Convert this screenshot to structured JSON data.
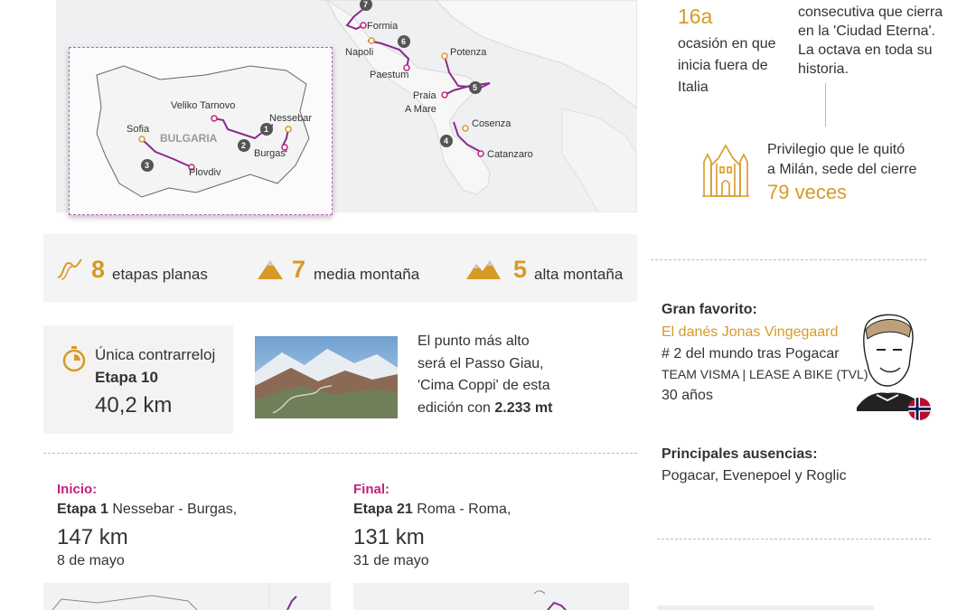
{
  "map": {
    "italy_labels": {
      "formia": "Formia",
      "napoli": "Napoli",
      "paestum": "Paestum",
      "potenza": "Potenza",
      "praia": "Praia",
      "amare": "A Mare",
      "cosenza": "Cosenza",
      "catanzaro": "Catanzaro"
    },
    "italy_stage_numbers": {
      "s7": "7",
      "s6": "6",
      "s5": "5",
      "s4": "4"
    },
    "bulgaria": {
      "country": "BULGARIA",
      "labels": {
        "veliko": "Veliko Tarnovo",
        "nessebar": "Nessebar",
        "sofia": "Sofia",
        "burgas": "Burgas",
        "plovdiv": "Plovdiv"
      },
      "stage_numbers": {
        "s1": "1",
        "s2": "2",
        "s3": "3"
      }
    }
  },
  "right_top": {
    "edition_num": "16a",
    "edition_text": "ocasión en que inicia fuera de Italia",
    "rome_text": "consecutiva que cierra en la 'Ciudad Eterna'. La octava en toda su historia.",
    "privilege_text_1": "Privilegio que le quitó",
    "privilege_text_2": "a Milán, sede del cierre",
    "privilege_count": "79 veces"
  },
  "stats": {
    "flat_num": "8",
    "flat_label": "etapas planas",
    "mid_num": "7",
    "mid_label": "media montaña",
    "high_num": "5",
    "high_label": "alta montaña"
  },
  "tt": {
    "title": "Única contrarreloj",
    "stage": "Etapa 10",
    "distance": "40,2 km"
  },
  "peak": {
    "line1": "El punto más alto",
    "line2": "será el Passo Giau,",
    "line3": "'Cima Coppi' de esta",
    "line4_prefix": "edición con ",
    "line4_bold": "2.233 mt"
  },
  "start": {
    "label": "Inicio:",
    "stage": "Etapa 1",
    "route": " Nessebar - Burgas,",
    "distance": "147 km",
    "date": "8 de mayo"
  },
  "finish": {
    "label": "Final:",
    "stage": "Etapa 21",
    "route": " Roma - Roma,",
    "distance": "131 km",
    "date": "31 de mayo"
  },
  "favorite": {
    "heading": "Gran favorito:",
    "name": "El danés Jonas Vingegaard",
    "rank": "# 2 del mundo tras Pogacar",
    "team": "TEAM VISMA | LEASE A BIKE (TVL)",
    "age": "30 años"
  },
  "absences": {
    "heading": "Principales ausencias:",
    "names": "Pogacar, Evenepoel y Roglic"
  },
  "colors": {
    "accent_gold": "#d79a28",
    "accent_pink": "#c0237d",
    "route_purple": "#8a2b8a"
  },
  "icons": [
    "flat-stage-icon",
    "medium-mountain-icon",
    "high-mountain-icon",
    "stopwatch-icon",
    "cathedral-icon",
    "norway-flag-icon"
  ]
}
